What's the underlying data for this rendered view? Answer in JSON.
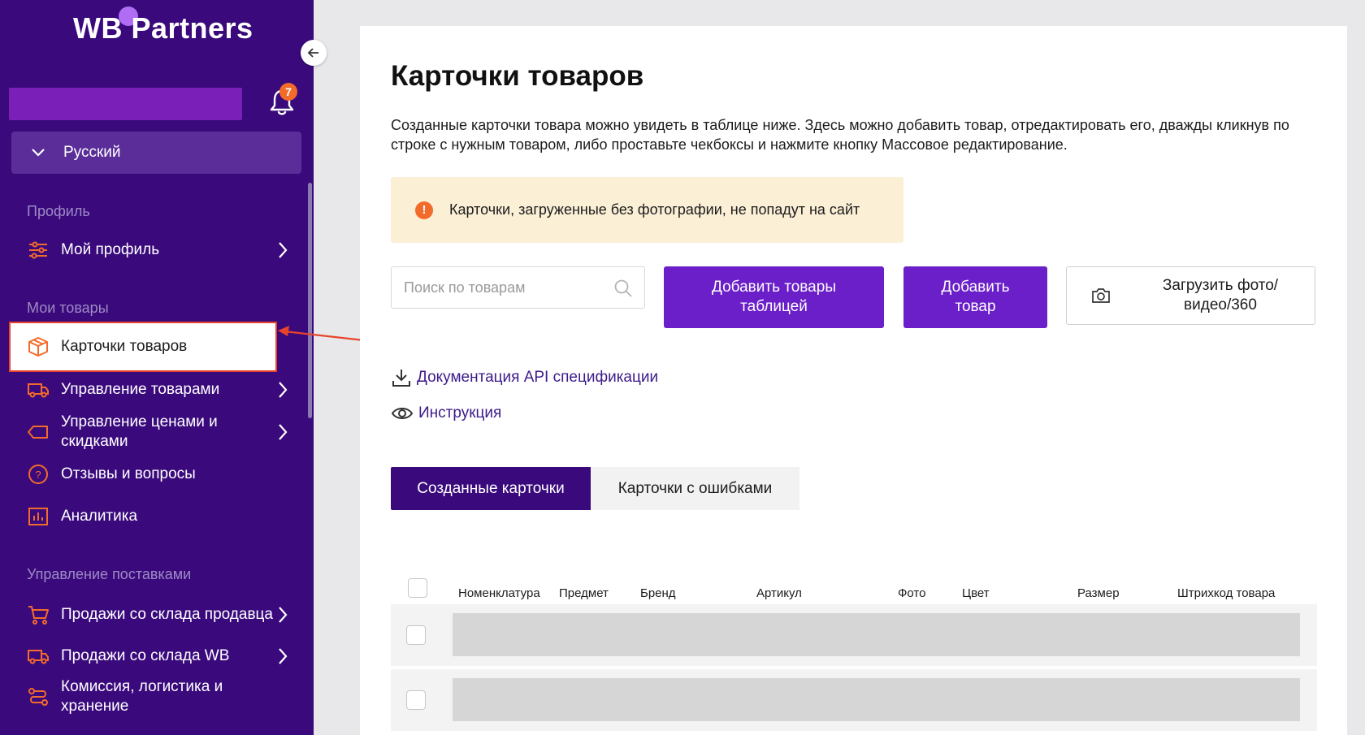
{
  "sidebar": {
    "logo": "WB Partners",
    "notifications_count": "7",
    "language": "Русский",
    "sections": [
      {
        "title": "Профиль"
      },
      {
        "title": "Мои товары"
      },
      {
        "title": "Управление поставками"
      }
    ],
    "items": [
      {
        "label": "Мой профиль",
        "icon": "sliders-icon"
      },
      {
        "label": "Карточки товаров",
        "icon": "box-icon"
      },
      {
        "label": "Управление товарами",
        "icon": "truck-icon"
      },
      {
        "label": "Управление ценами и скидками",
        "icon": "tag-icon"
      },
      {
        "label": "Отзывы и вопросы",
        "icon": "question-icon"
      },
      {
        "label": "Аналитика",
        "icon": "chart-icon"
      },
      {
        "label": "Продажи со склада продавца",
        "icon": "cart-icon"
      },
      {
        "label": "Продажи со склада WB",
        "icon": "truck-icon"
      },
      {
        "label": "Комиссия, логистика и хранение",
        "icon": "route-icon"
      }
    ]
  },
  "main": {
    "title": "Карточки товаров",
    "description": "Созданные карточки товара можно увидеть в таблице ниже. Здесь можно добавить товар, отредактировать его, дважды кликнув по строке с нужным товаром, либо проставьте чекбоксы и нажмите кнопку Массовое редактирование.",
    "warning": "Карточки, загруженные без фотографии, не попадут на сайт",
    "search_placeholder": "Поиск по товарам",
    "buttons": {
      "add_table_line1": "Добавить товары",
      "add_table_line2": "таблицей",
      "add_item_line1": "Добавить",
      "add_item_line2": "товар",
      "upload_line1": "Загрузить фото/",
      "upload_line2": "видео/360"
    },
    "links": {
      "api_docs": "Документация API спецификации",
      "instruction": "Инструкция"
    },
    "tabs": [
      "Созданные карточки",
      "Карточки с ошибками"
    ],
    "table": {
      "columns": [
        "Номенклатура",
        "Предмет",
        "Бренд",
        "Артикул",
        "Фото",
        "Цвет",
        "Размер",
        "Штрихкод товара"
      ]
    }
  },
  "colors": {
    "sidebar_bg": "#3a0a7d",
    "primary": "#6a1fc9",
    "accent": "#f36b2a",
    "annotation": "#e8432b"
  }
}
